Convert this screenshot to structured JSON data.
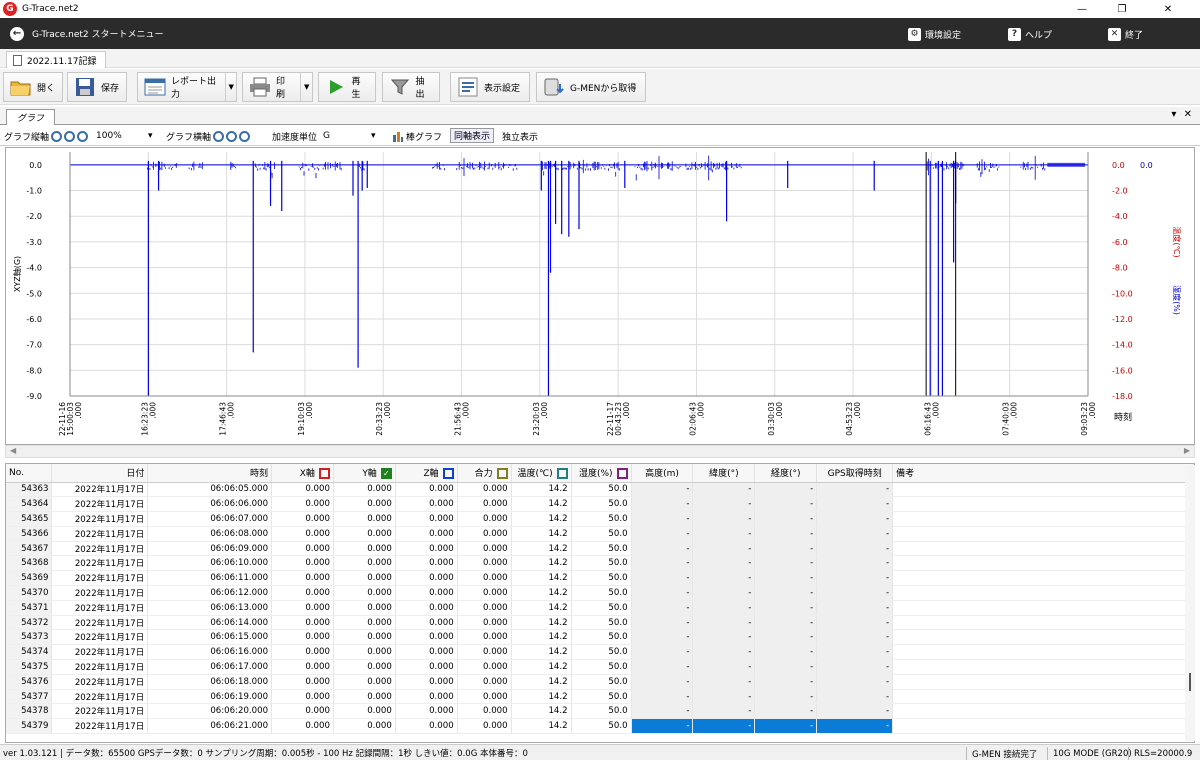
{
  "window": {
    "title": "G-Trace.net2"
  },
  "menubar": {
    "title": "G-Trace.net2 スタートメニュー",
    "settings": "環境設定",
    "help": "ヘルプ",
    "exit": "終了"
  },
  "doc_tab": {
    "label": "2022.11.17記録"
  },
  "toolbar": {
    "open": "開く",
    "save": "保存",
    "report": "レポート出力",
    "print": "印刷",
    "play": "再生",
    "extract": "抽出",
    "display_settings": "表示設定",
    "get_from_gmen": "G-MENから取得"
  },
  "graph_tab": {
    "label": "グラフ"
  },
  "graph_tools": {
    "vertical_axis": "グラフ縦軸",
    "zoom": "100%",
    "horizontal_axis": "グラフ横軸",
    "accel_unit_label": "加速度単位",
    "accel_unit": "G",
    "bar_graph": "棒グラフ",
    "same_display": "同軸表示",
    "separate_display": "独立表示"
  },
  "chart_data": {
    "type": "line",
    "ylabel": "XYZ軸(G)",
    "xlabel": "時刻",
    "right_label_1": "温度(℃)",
    "right_label_2": "湿度(%)",
    "y_ticks": [
      "0.0",
      "-1.0",
      "-2.0",
      "-3.0",
      "-4.0",
      "-5.0",
      "-6.0",
      "-7.0",
      "-8.0",
      "-9.0"
    ],
    "ylim": [
      -9.0,
      0.5
    ],
    "right_ticks": [
      "0.0",
      "-2.0",
      "-4.0",
      "-6.0",
      "-8.0",
      "-10.0",
      "-12.0",
      "-14.0",
      "-16.0",
      "-18.0"
    ],
    "right_top_2": "0.0",
    "x_ticks": [
      {
        "d": "22-11-16",
        "t": "15:00:03",
        "ms": ".000"
      },
      {
        "d": "",
        "t": "16:23:23",
        "ms": ".000"
      },
      {
        "d": "",
        "t": "17:46:43",
        "ms": ".000"
      },
      {
        "d": "",
        "t": "19:10:03",
        "ms": ".000"
      },
      {
        "d": "",
        "t": "20:33:23",
        "ms": ".000"
      },
      {
        "d": "",
        "t": "21:56:43",
        "ms": ".000"
      },
      {
        "d": "",
        "t": "23:20:03",
        "ms": ".000"
      },
      {
        "d": "22-11-17",
        "t": "00:43:23",
        "ms": ".000"
      },
      {
        "d": "",
        "t": "02:06:43",
        "ms": ".000"
      },
      {
        "d": "",
        "t": "03:30:03",
        "ms": ".000"
      },
      {
        "d": "",
        "t": "04:53:23",
        "ms": ".000"
      },
      {
        "d": "",
        "t": "06:16:43",
        "ms": ".000"
      },
      {
        "d": "",
        "t": "07:40:03",
        "ms": ".000"
      },
      {
        "d": "",
        "t": "09:03:23",
        "ms": ".000"
      }
    ],
    "spikes": [
      {
        "t": 0.077,
        "v": -9.0
      },
      {
        "t": 0.087,
        "v": -1.0
      },
      {
        "t": 0.18,
        "v": -7.3
      },
      {
        "t": 0.197,
        "v": -1.6
      },
      {
        "t": 0.208,
        "v": -1.8
      },
      {
        "t": 0.278,
        "v": -1.2
      },
      {
        "t": 0.283,
        "v": -7.9
      },
      {
        "t": 0.287,
        "v": -1.0
      },
      {
        "t": 0.292,
        "v": -0.9
      },
      {
        "t": 0.463,
        "v": -1.0
      },
      {
        "t": 0.47,
        "v": -9.0
      },
      {
        "t": 0.472,
        "v": -4.2
      },
      {
        "t": 0.477,
        "v": -2.3
      },
      {
        "t": 0.483,
        "v": -2.7
      },
      {
        "t": 0.49,
        "v": -2.8
      },
      {
        "t": 0.5,
        "v": -2.5
      },
      {
        "t": 0.545,
        "v": -0.9
      },
      {
        "t": 0.645,
        "v": -2.2
      },
      {
        "t": 0.705,
        "v": -0.9
      },
      {
        "t": 0.79,
        "v": -1.0
      },
      {
        "t": 0.845,
        "v": -9.0
      },
      {
        "t": 0.853,
        "v": -9.0
      },
      {
        "t": 0.857,
        "v": -9.0
      },
      {
        "t": 0.868,
        "v": -3.8
      },
      {
        "t": 0.87,
        "v": -1.5
      }
    ],
    "noisy_segments": [
      [
        0.075,
        0.105
      ],
      [
        0.117,
        0.13
      ],
      [
        0.158,
        0.163
      ],
      [
        0.182,
        0.202
      ],
      [
        0.224,
        0.268
      ],
      [
        0.283,
        0.29
      ],
      [
        0.356,
        0.368
      ],
      [
        0.38,
        0.44
      ],
      [
        0.463,
        0.54
      ],
      [
        0.555,
        0.6
      ],
      [
        0.605,
        0.66
      ],
      [
        0.842,
        0.88
      ],
      [
        0.89,
        0.915
      ],
      [
        0.934,
        0.958
      ]
    ]
  },
  "table": {
    "columns": [
      "No.",
      "日付",
      "時刻",
      "X軸",
      "Y軸",
      "Z軸",
      "合力",
      "温度(℃)",
      "湿度(%)",
      "高度(m)",
      "緯度(°)",
      "経度(°)",
      "GPS取得時刻",
      "備考"
    ],
    "checkbox_colors": [
      "#d02020",
      "#208020",
      "#1040d0",
      "#808020",
      "#208080",
      "#802080"
    ],
    "rows": [
      [
        "54363",
        "2022年11月17日",
        "06:06:05.000",
        "0.000",
        "0.000",
        "0.000",
        "0.000",
        "14.2",
        "50.0",
        "-",
        "-",
        "-",
        "-",
        ""
      ],
      [
        "54364",
        "2022年11月17日",
        "06:06:06.000",
        "0.000",
        "0.000",
        "0.000",
        "0.000",
        "14.2",
        "50.0",
        "-",
        "-",
        "-",
        "-",
        ""
      ],
      [
        "54365",
        "2022年11月17日",
        "06:06:07.000",
        "0.000",
        "0.000",
        "0.000",
        "0.000",
        "14.2",
        "50.0",
        "-",
        "-",
        "-",
        "-",
        ""
      ],
      [
        "54366",
        "2022年11月17日",
        "06:06:08.000",
        "0.000",
        "0.000",
        "0.000",
        "0.000",
        "14.2",
        "50.0",
        "-",
        "-",
        "-",
        "-",
        ""
      ],
      [
        "54367",
        "2022年11月17日",
        "06:06:09.000",
        "0.000",
        "0.000",
        "0.000",
        "0.000",
        "14.2",
        "50.0",
        "-",
        "-",
        "-",
        "-",
        ""
      ],
      [
        "54368",
        "2022年11月17日",
        "06:06:10.000",
        "0.000",
        "0.000",
        "0.000",
        "0.000",
        "14.2",
        "50.0",
        "-",
        "-",
        "-",
        "-",
        ""
      ],
      [
        "54369",
        "2022年11月17日",
        "06:06:11.000",
        "0.000",
        "0.000",
        "0.000",
        "0.000",
        "14.2",
        "50.0",
        "-",
        "-",
        "-",
        "-",
        ""
      ],
      [
        "54370",
        "2022年11月17日",
        "06:06:12.000",
        "0.000",
        "0.000",
        "0.000",
        "0.000",
        "14.2",
        "50.0",
        "-",
        "-",
        "-",
        "-",
        ""
      ],
      [
        "54371",
        "2022年11月17日",
        "06:06:13.000",
        "0.000",
        "0.000",
        "0.000",
        "0.000",
        "14.2",
        "50.0",
        "-",
        "-",
        "-",
        "-",
        ""
      ],
      [
        "54372",
        "2022年11月17日",
        "06:06:14.000",
        "0.000",
        "0.000",
        "0.000",
        "0.000",
        "14.2",
        "50.0",
        "-",
        "-",
        "-",
        "-",
        ""
      ],
      [
        "54373",
        "2022年11月17日",
        "06:06:15.000",
        "0.000",
        "0.000",
        "0.000",
        "0.000",
        "14.2",
        "50.0",
        "-",
        "-",
        "-",
        "-",
        ""
      ],
      [
        "54374",
        "2022年11月17日",
        "06:06:16.000",
        "0.000",
        "0.000",
        "0.000",
        "0.000",
        "14.2",
        "50.0",
        "-",
        "-",
        "-",
        "-",
        ""
      ],
      [
        "54375",
        "2022年11月17日",
        "06:06:17.000",
        "0.000",
        "0.000",
        "0.000",
        "0.000",
        "14.2",
        "50.0",
        "-",
        "-",
        "-",
        "-",
        ""
      ],
      [
        "54376",
        "2022年11月17日",
        "06:06:18.000",
        "0.000",
        "0.000",
        "0.000",
        "0.000",
        "14.2",
        "50.0",
        "-",
        "-",
        "-",
        "-",
        ""
      ],
      [
        "54377",
        "2022年11月17日",
        "06:06:19.000",
        "0.000",
        "0.000",
        "0.000",
        "0.000",
        "14.2",
        "50.0",
        "-",
        "-",
        "-",
        "-",
        ""
      ],
      [
        "54378",
        "2022年11月17日",
        "06:06:20.000",
        "0.000",
        "0.000",
        "0.000",
        "0.000",
        "14.2",
        "50.0",
        "-",
        "-",
        "-",
        "-",
        ""
      ],
      [
        "54379",
        "2022年11月17日",
        "06:06:21.000",
        "0.000",
        "0.000",
        "0.000",
        "0.000",
        "14.2",
        "50.0",
        "-",
        "-",
        "-",
        "-",
        ""
      ]
    ],
    "selected_row": 16
  },
  "status": {
    "left": "ver 1.03.121 | データ数：65500  GPSデータ数：0  サンプリング周期：0.005秒 - 100 Hz  記録間隔：1秒  しきい値：0.0G  本体番号：0",
    "connection": "G-MEN 接続完了",
    "mode": "10G MODE (GR20)",
    "rls": "RLS=20000.9"
  },
  "colors": {
    "series": "#0000dd",
    "temp_axis": "#cc0000",
    "hum_axis": "#0000cc",
    "selection": "#0a7bd6"
  }
}
